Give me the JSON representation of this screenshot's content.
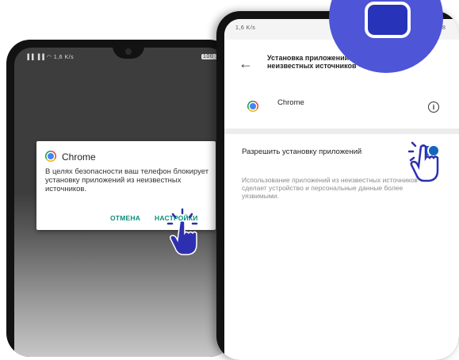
{
  "left_phone": {
    "status": "▐▐ ▐▐ ◠ 1,6 K/s",
    "battery": "100 1",
    "dialog": {
      "title": "Chrome",
      "message": "В целях безопасности ваш телефон блокирует установку приложений из неизвестных источников.",
      "cancel_label": "ОТМЕНА",
      "settings_label": "НАСТРОЙКИ"
    }
  },
  "right_phone": {
    "status": "1,6 K/s",
    "status_right": "8",
    "header_title": "Установка приложений из неизвестных источников",
    "app_name": "Chrome",
    "setting_label": "Разрешить установку приложений",
    "setting_description": "Использование приложений из неизвестных источников сделает устройство и персональные данные более уязвимыми.",
    "toggle_on": true
  },
  "colors": {
    "accent_blue": "#1565c0",
    "teal_button": "#0a8f7a",
    "badge_purple": "#4e55d6",
    "hand_purple": "#2e2fb0"
  },
  "icons": [
    "chrome-icon",
    "info-icon",
    "back-arrow-icon",
    "hand-pointer-icon",
    "screen-badge-icon"
  ]
}
